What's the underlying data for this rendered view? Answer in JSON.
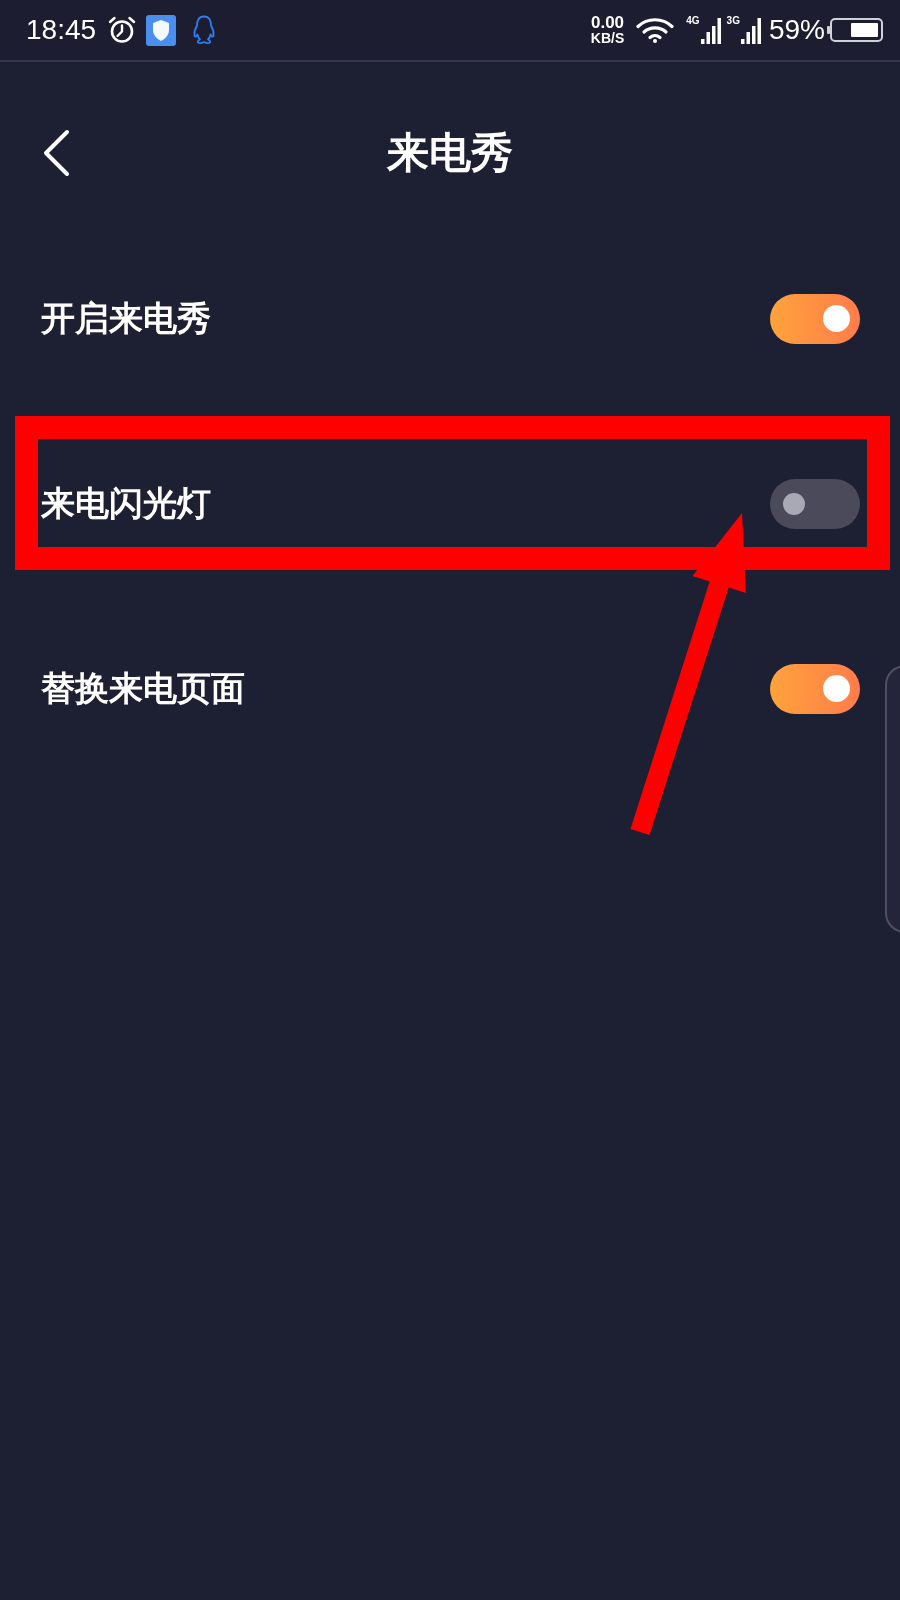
{
  "status_bar": {
    "time": "18:45",
    "net_speed": {
      "value": "0.00",
      "unit": "KB/S"
    },
    "networks": [
      {
        "label": "4G"
      },
      {
        "label": "3G"
      }
    ],
    "battery": "59%"
  },
  "header": {
    "title": "来电秀"
  },
  "settings": [
    {
      "label": "开启来电秀",
      "on": true,
      "highlighted": false
    },
    {
      "label": "来电闪光灯",
      "on": false,
      "highlighted": true
    },
    {
      "label": "替换来电页面",
      "on": true,
      "highlighted": false
    }
  ]
}
